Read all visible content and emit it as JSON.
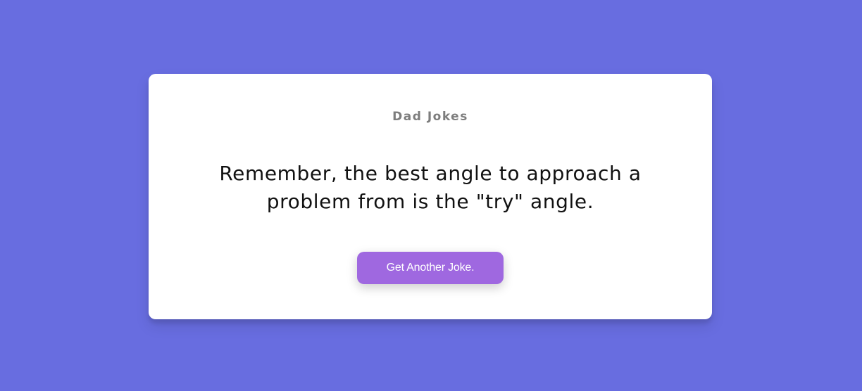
{
  "header": {
    "title": "Dad Jokes"
  },
  "joke": {
    "text": "Remember, the best angle to approach a problem from is the \"try\" angle."
  },
  "actions": {
    "get_joke_label": "Get Another Joke."
  },
  "colors": {
    "background": "#686de0",
    "card": "#ffffff",
    "button": "#9f68e0",
    "title": "#7d7d7d",
    "joke_text": "#111111"
  }
}
